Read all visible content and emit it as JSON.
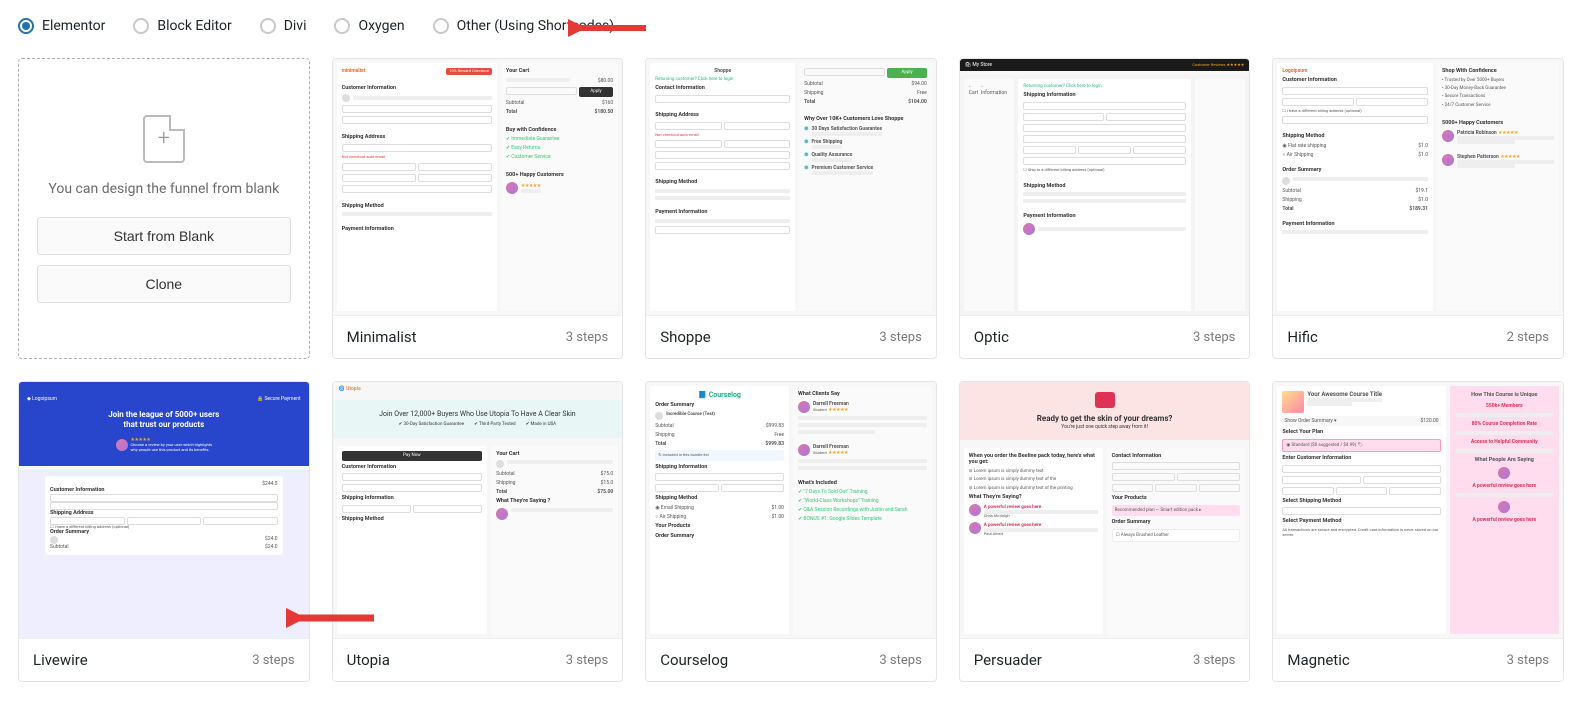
{
  "filters": {
    "options": [
      {
        "id": "elementor",
        "label": "Elementor",
        "selected": true
      },
      {
        "id": "block-editor",
        "label": "Block Editor",
        "selected": false
      },
      {
        "id": "divi",
        "label": "Divi",
        "selected": false
      },
      {
        "id": "oxygen",
        "label": "Oxygen",
        "selected": false
      },
      {
        "id": "other",
        "label": "Other (Using Shortcodes)",
        "selected": false
      }
    ]
  },
  "blank_card": {
    "message": "You can design the funnel from blank",
    "start_label": "Start from Blank",
    "clone_label": "Clone"
  },
  "templates": [
    {
      "id": "minimalist",
      "name": "Minimalist",
      "steps_label": "3 steps",
      "steps": 3
    },
    {
      "id": "shoppe",
      "name": "Shoppe",
      "steps_label": "3 steps",
      "steps": 3
    },
    {
      "id": "optic",
      "name": "Optic",
      "steps_label": "3 steps",
      "steps": 3
    },
    {
      "id": "hific",
      "name": "Hific",
      "steps_label": "2 steps",
      "steps": 2
    },
    {
      "id": "livewire",
      "name": "Livewire",
      "steps_label": "3 steps",
      "steps": 3
    },
    {
      "id": "utopia",
      "name": "Utopia",
      "steps_label": "3 steps",
      "steps": 3
    },
    {
      "id": "courselog",
      "name": "Courselog",
      "steps_label": "3 steps",
      "steps": 3
    },
    {
      "id": "persuader",
      "name": "Persuader",
      "steps_label": "3 steps",
      "steps": 3
    },
    {
      "id": "magnetic",
      "name": "Magnetic",
      "steps_label": "3 steps",
      "steps": 3
    }
  ],
  "thumbs": {
    "minimalist": {
      "brand": "minimalist",
      "badge": "10% Reward Checkout",
      "sec_customer": "Customer Information",
      "sec_shipping": "Shipping Address",
      "sec_method": "Shipping Method",
      "sec_payment": "Payment Information",
      "cart_title": "Your Cart",
      "total_label": "Total",
      "total_value": "$180.50",
      "confidence": "Buy with Confidence",
      "happy": "500+ Happy Customers"
    },
    "shoppe": {
      "brand": "Shoppe",
      "sec_contact": "Contact Information",
      "sec_shipping": "Shipping Address",
      "sec_method": "Shipping Method",
      "sec_payment": "Payment Information",
      "apply": "Apply",
      "total": "$104.00",
      "why": "Why Over 10K+ Customers Love Shoppe"
    },
    "optic": {
      "brand": "My Store",
      "sec_shipping": "Shipping Information",
      "sec_method": "Shipping Method",
      "sec_payment": "Payment Information"
    },
    "hific": {
      "brand": "Logoipsum",
      "sec_customer": "Customer Information",
      "sec_method": "Shipping Method",
      "sec_summary": "Order Summary",
      "total_label": "Total",
      "total_value": "$189.31",
      "sec_payment": "Payment Information",
      "confidence": "Shop With Confidence",
      "happy": "5000+ Happy Customers"
    },
    "livewire": {
      "brand": "Logoipsum",
      "headline1": "Join the league of 5000+ users",
      "headline2": "that trust our products",
      "sec_customer": "Customer Information",
      "sec_shipping": "Shipping Address",
      "sec_summary": "Order Summary",
      "price": "$244.5"
    },
    "utopia": {
      "brand": "Utopia",
      "headline": "Join Over 12,000+ Buyers Who Use Utopia To Have A Clear Skin",
      "pay": "Pay Now",
      "cart": "Your Cart",
      "sec_customer": "Customer Information",
      "sec_shipping": "Shipping Information",
      "sec_method": "Shipping Method",
      "saying": "What They're Saying ?"
    },
    "courselog": {
      "brand": "Courselog",
      "sec_summary": "Order Summary",
      "total_label": "Total",
      "total_value": "$999.83",
      "sec_shipping": "Shipping Information",
      "sec_method": "Shipping Method",
      "sec_products": "Your Products",
      "clients": "What Clients Say",
      "included": "What's Included"
    },
    "persuader": {
      "headline": "Ready to get the skin of your dreams?",
      "sub": "You're just one quick step away from it!",
      "benefits_title": "When you order the Beeline pack today, here's what you get:",
      "saying": "What They're Saying?",
      "sec_contact": "Contact Information",
      "sec_products": "Your Products",
      "sec_summary": "Order Summary"
    },
    "magnetic": {
      "course": "Your Awesome Course Title",
      "total": "$120.00",
      "sec_plan": "Select Your Plan",
      "sec_customer": "Enter Customer Information",
      "sec_method": "Select Shipping Method",
      "sec_payment": "Select Payment Method",
      "unique": "How This Course is Unique",
      "members": "550k+ Members",
      "completion": "80% Course Completion Rate",
      "community": "Access to Helpful Community",
      "people": "What People Are Saying",
      "review": "A powerful review goes here"
    }
  },
  "annotations": {
    "arrow_top": "arrow-pointing-left-to-filters",
    "arrow_mid": "arrow-pointing-left-to-livewire"
  }
}
